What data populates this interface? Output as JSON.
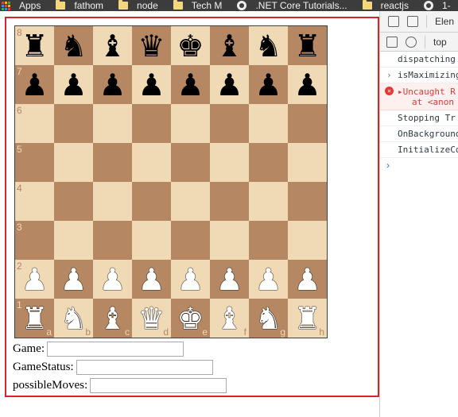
{
  "bookmarks": [
    {
      "label": "Apps",
      "icon": "apps-icon"
    },
    {
      "label": "fathom",
      "icon": "folder-icon"
    },
    {
      "label": "node",
      "icon": "folder-icon"
    },
    {
      "label": "Tech M",
      "icon": "folder-icon"
    },
    {
      "label": ".NET Core Tutorials...",
      "icon": "globe-icon"
    },
    {
      "label": "reactjs",
      "icon": "folder-icon"
    },
    {
      "label": "1-",
      "icon": "globe-icon"
    }
  ],
  "colors": {
    "light_square": "#f0d9b5",
    "dark_square": "#b58863",
    "frame_border": "#d6242b"
  },
  "board": {
    "ranks": [
      "8",
      "7",
      "6",
      "5",
      "4",
      "3",
      "2",
      "1"
    ],
    "files": [
      "a",
      "b",
      "c",
      "d",
      "e",
      "f",
      "g",
      "h"
    ],
    "rows": [
      [
        "b:♜",
        "b:♞",
        "b:♝",
        "b:♛",
        "b:♚",
        "b:♝",
        "b:♞",
        "b:♜"
      ],
      [
        "b:♟",
        "b:♟",
        "b:♟",
        "b:♟",
        "b:♟",
        "b:♟",
        "b:♟",
        "b:♟"
      ],
      [
        "",
        "",
        "",
        "",
        "",
        "",
        "",
        ""
      ],
      [
        "",
        "",
        "",
        "",
        "",
        "",
        "",
        ""
      ],
      [
        "",
        "",
        "",
        "",
        "",
        "",
        "",
        ""
      ],
      [
        "",
        "",
        "",
        "",
        "",
        "",
        "",
        ""
      ],
      [
        "w:♟",
        "w:♟",
        "w:♟",
        "w:♟",
        "w:♟",
        "w:♟",
        "w:♟",
        "w:♟"
      ],
      [
        "w:♜",
        "w:♞",
        "w:♝",
        "w:♛",
        "w:♚",
        "w:♝",
        "w:♞",
        "w:♜"
      ]
    ]
  },
  "form": {
    "game_label": "Game:",
    "game_value": "",
    "status_label": "GameStatus:",
    "status_value": "",
    "moves_label": "possibleMoves:",
    "moves_value": ""
  },
  "devtools": {
    "tab_label": "Elen",
    "context": "top",
    "messages": [
      {
        "text": "dispatching",
        "type": "log",
        "arrow": ""
      },
      {
        "text": "isMaximizing",
        "type": "log",
        "arrow": "›"
      },
      {
        "text": "▸Uncaught R",
        "text2": "at <anon",
        "type": "error",
        "arrow": ""
      },
      {
        "text": "Stopping Tr",
        "type": "log",
        "arrow": ""
      },
      {
        "text": "OnBackground",
        "type": "log",
        "arrow": ""
      },
      {
        "text": "InitializeCo",
        "type": "log",
        "arrow": ""
      }
    ],
    "prompt": "›"
  }
}
